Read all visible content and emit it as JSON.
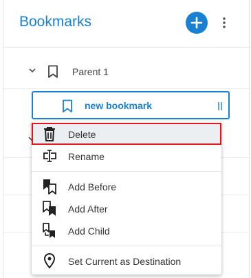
{
  "header": {
    "title": "Bookmarks"
  },
  "tree": {
    "parent_label": "Parent 1",
    "edit_label": "new bookmark"
  },
  "context_menu": {
    "items": [
      {
        "label": "Delete",
        "icon": "trash-icon"
      },
      {
        "label": "Rename",
        "icon": "rename-icon"
      },
      {
        "label": "Add Before",
        "icon": "add-before-icon"
      },
      {
        "label": "Add After",
        "icon": "add-after-icon"
      },
      {
        "label": "Add Child",
        "icon": "add-child-icon"
      },
      {
        "label": "Set Current as Destination",
        "icon": "location-pin-icon"
      }
    ],
    "selected_index": 0
  },
  "colors": {
    "accent": "#1a80d2",
    "selection_outline": "#e0161b",
    "selected_bg": "#eceff1"
  }
}
